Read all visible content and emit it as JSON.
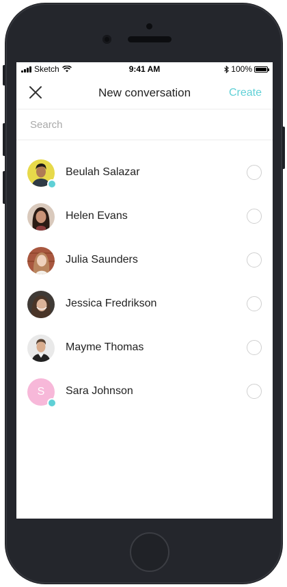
{
  "status_bar": {
    "carrier": "Sketch",
    "time": "9:41 AM",
    "battery": "100%"
  },
  "nav": {
    "title": "New conversation",
    "create_label": "Create",
    "close_icon": "close-icon"
  },
  "search": {
    "placeholder": "Search",
    "value": ""
  },
  "contacts": [
    {
      "name": "Beulah Salazar",
      "online": true
    },
    {
      "name": "Helen Evans",
      "online": false
    },
    {
      "name": "Julia Saunders",
      "online": false
    },
    {
      "name": "Jessica Fredrikson",
      "online": false
    },
    {
      "name": "Mayme Thomas",
      "online": false
    },
    {
      "name": "Sara Johnson",
      "initial": "S",
      "online": true
    }
  ],
  "colors": {
    "accent": "#5fd0d6",
    "initial_avatar_bg": "#f7b8d9",
    "phone_body": "#24262c"
  }
}
